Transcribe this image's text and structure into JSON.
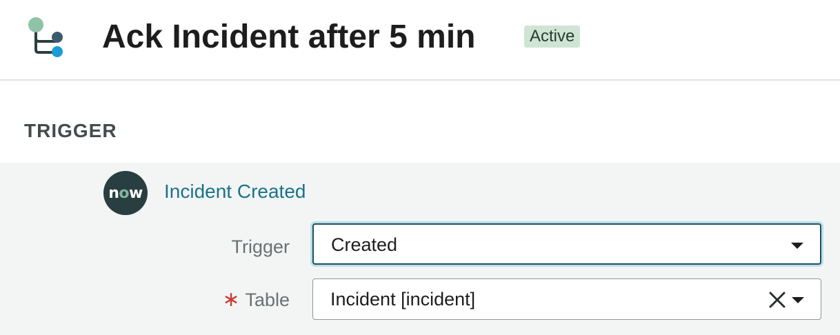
{
  "header": {
    "title": "Ack Incident after 5 min",
    "status_badge": "Active"
  },
  "section": {
    "label": "TRIGGER"
  },
  "trigger": {
    "logo_text_n": "n",
    "logo_text_o": "o",
    "logo_text_w": "w",
    "name": "Incident Created",
    "fields": [
      {
        "label": "Trigger",
        "value": "Created",
        "required": false
      },
      {
        "label": "Table",
        "value": "Incident [incident]",
        "required": true,
        "required_marker": "∗"
      }
    ]
  },
  "colors": {
    "accent_link": "#1a7389",
    "badge_bg": "#cfe5d3",
    "panel_bg": "#f3f5f5",
    "required": "#c83c36",
    "focus_border": "#1f4f5c"
  },
  "icons": {
    "flow": "flow-branch-icon",
    "brand": "servicenow-logo",
    "dropdown": "chevron-down-icon",
    "clear": "close-icon"
  }
}
